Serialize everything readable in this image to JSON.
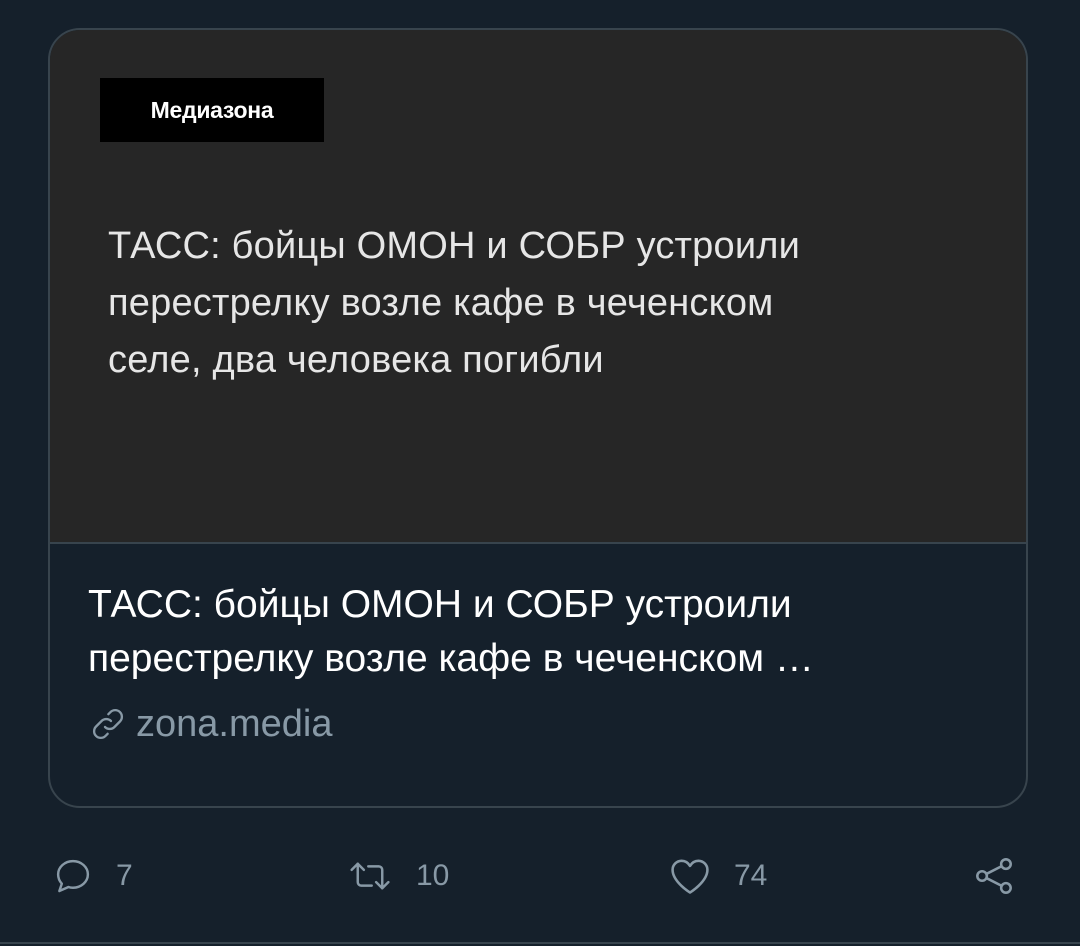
{
  "card": {
    "image": {
      "logo_text": "Медиазона",
      "headline_lines": [
        "ТАСС: бойцы ОМОН и СОБР устроили",
        "перестрелку возле кафе в чеченском",
        "селе, два человека погибли"
      ]
    },
    "title_lines": [
      "ТАСС: бойцы ОМОН и СОБР устроили",
      "перестрелку возле кафе в чеченском …"
    ],
    "domain": "zona.media",
    "domain_icon": "link-icon"
  },
  "actions": {
    "reply": {
      "icon": "reply-icon",
      "count": "7"
    },
    "retweet": {
      "icon": "retweet-icon",
      "count": "10"
    },
    "like": {
      "icon": "heart-icon",
      "count": "74"
    },
    "share": {
      "icon": "share-icon"
    }
  },
  "colors": {
    "background": "#15202b",
    "card_border": "#38444d",
    "image_background": "#262626",
    "logo_background": "#000000",
    "secondary_text": "#8899a6"
  }
}
